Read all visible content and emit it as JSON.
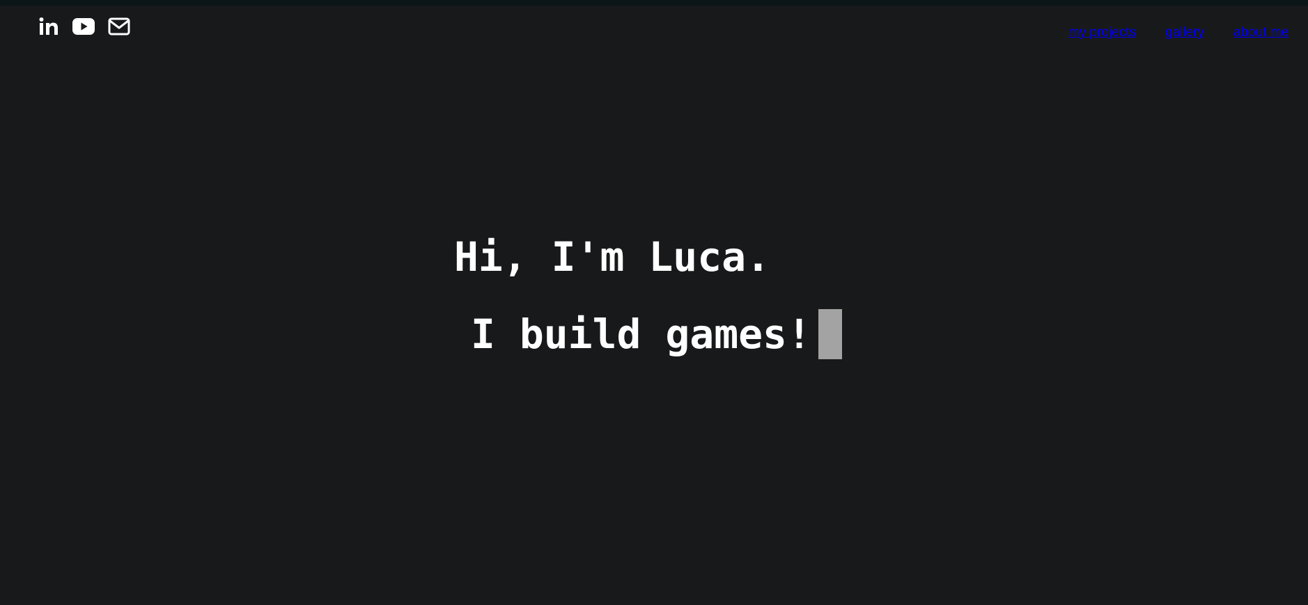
{
  "social": {
    "linkedin_icon": "linkedin-icon",
    "youtube_icon": "youtube-icon",
    "email_icon": "envelope-icon"
  },
  "nav": {
    "projects": "my projects",
    "gallery": "gallery",
    "about": "about me"
  },
  "hero": {
    "greeting": "Hi, I'm Luca.",
    "tagline": "I build games!"
  },
  "colors": {
    "background": "#18191b",
    "link": "#0000ee",
    "text": "#ffffff",
    "cursor": "#a3a3a3"
  }
}
